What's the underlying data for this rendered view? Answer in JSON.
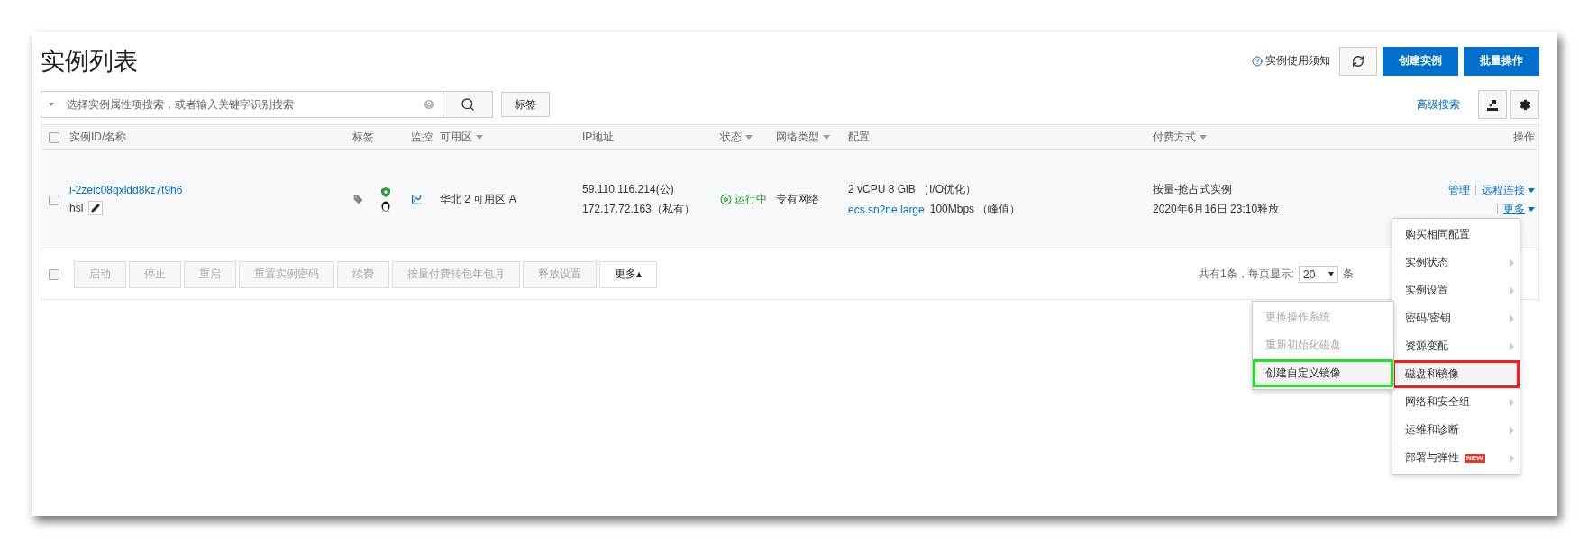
{
  "page_title": "实例列表",
  "header_actions": {
    "notice_link": "实例使用须知",
    "buttons": [
      {
        "label": "创建实例"
      },
      {
        "label": "批量操作"
      }
    ]
  },
  "search": {
    "placeholder": "选择实例属性项搜索，或者输入关键字识别搜索",
    "tag_button": "标签",
    "advanced_link": "高级搜索"
  },
  "table": {
    "select_all_checked": false,
    "columns": [
      {
        "label": "实例ID/名称",
        "filter": false
      },
      {
        "label": "标签",
        "filter": false
      },
      {
        "label": "监控",
        "filter": false
      },
      {
        "label": "可用区",
        "filter": true
      },
      {
        "label": "IP地址",
        "filter": false
      },
      {
        "label": "状态",
        "filter": true
      },
      {
        "label": "网络类型",
        "filter": true
      },
      {
        "label": "配置",
        "filter": false
      },
      {
        "label": "付费方式",
        "filter": true
      },
      {
        "label": "操作",
        "filter": false
      }
    ],
    "rows": [
      {
        "checked": false,
        "instance_id": "i-2zeic08qxldd8kz7t9h6",
        "name": "hsl",
        "zone": "华北 2 可用区 A",
        "public_ip": "59.110.116.214(公)",
        "private_ip": "172.17.72.163（私有）",
        "status": "运行中",
        "network": "专有网络",
        "spec": "2 vCPU 8 GiB （I/O优化）",
        "instance_type": "ecs.sn2ne.large",
        "bandwidth": "100Mbps （峰值）",
        "billing": "按量-抢占式实例",
        "release": "2020年6月16日 23:10释放",
        "actions": [
          "管理",
          "远程连接",
          "更多"
        ]
      }
    ]
  },
  "footer": {
    "select_all_checked": false,
    "buttons": [
      {
        "label": "启动",
        "disabled": true
      },
      {
        "label": "停止",
        "disabled": true
      },
      {
        "label": "重启",
        "disabled": true
      },
      {
        "label": "重置实例密码",
        "disabled": true
      },
      {
        "label": "续费",
        "disabled": true
      },
      {
        "label": "按量付费转包年包月",
        "disabled": true
      },
      {
        "label": "释放设置",
        "disabled": true
      },
      {
        "label": "更多▴",
        "disabled": false
      }
    ],
    "total": "共有1条，每页显示:",
    "page_size": "20",
    "unit": "条"
  },
  "more_menu": [
    {
      "label": "购买相同配置",
      "arrow": false,
      "outlined": false
    },
    {
      "label": "实例状态",
      "arrow": true,
      "outlined": false
    },
    {
      "label": "实例设置",
      "arrow": true,
      "outlined": false
    },
    {
      "label": "密码/密钥",
      "arrow": true,
      "outlined": false
    },
    {
      "label": "资源变配",
      "arrow": true,
      "outlined": false
    },
    {
      "label": "磁盘和镜像",
      "arrow": false,
      "outlined": true
    },
    {
      "label": "网络和安全组",
      "arrow": true,
      "outlined": false
    },
    {
      "label": "运维和诊断",
      "arrow": true,
      "outlined": false
    },
    {
      "label": "部署与弹性",
      "arrow": true,
      "outlined": false,
      "badge": "NEW"
    }
  ],
  "submenu": [
    {
      "label": "更换操作系统",
      "disabled": true,
      "outlined": false
    },
    {
      "label": "重新初始化磁盘",
      "disabled": true,
      "outlined": false
    },
    {
      "label": "创建自定义镜像",
      "disabled": false,
      "outlined": true
    }
  ]
}
